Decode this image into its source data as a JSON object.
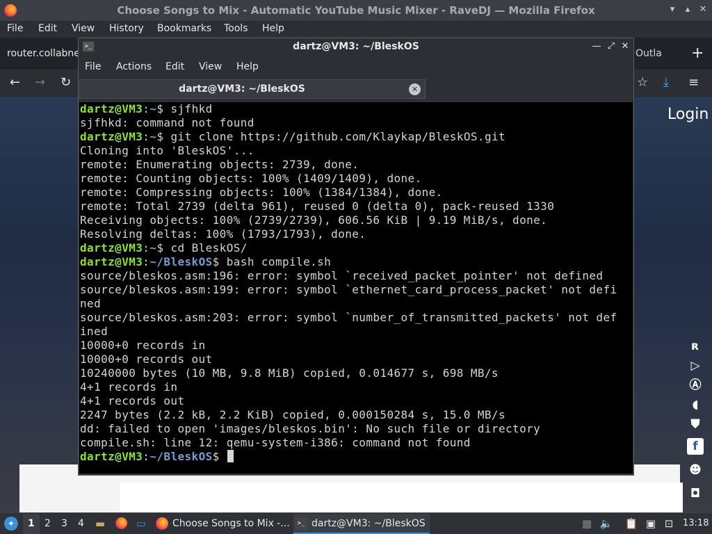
{
  "firefox": {
    "window_title": "Choose Songs to Mix - Automatic YouTube Music Mixer - RaveDJ — Mozilla Firefox",
    "menu": [
      "File",
      "Edit",
      "View",
      "History",
      "Bookmarks",
      "Tools",
      "Help"
    ],
    "tab_left_label": "router.collabne",
    "tab_right_label": "Outla",
    "page_login": "Login"
  },
  "terminal": {
    "window_title": "dartz@VM3: ~/BleskOS",
    "menu": [
      "File",
      "Actions",
      "Edit",
      "View",
      "Help"
    ],
    "tab_label": "dartz@VM3: ~/BleskOS",
    "lines": [
      {
        "user": "dartz@VM3",
        "path": "~",
        "cmd": " sjfhkd"
      },
      {
        "text": "sjfhkd: command not found"
      },
      {
        "user": "dartz@VM3",
        "path": "~",
        "cmd": " git clone https://github.com/Klaykap/BleskOS.git"
      },
      {
        "text": "Cloning into 'BleskOS'..."
      },
      {
        "text": "remote: Enumerating objects: 2739, done."
      },
      {
        "text": "remote: Counting objects: 100% (1409/1409), done."
      },
      {
        "text": "remote: Compressing objects: 100% (1384/1384), done."
      },
      {
        "text": "remote: Total 2739 (delta 961), reused 0 (delta 0), pack-reused 1330"
      },
      {
        "text": "Receiving objects: 100% (2739/2739), 606.56 KiB | 9.19 MiB/s, done."
      },
      {
        "text": "Resolving deltas: 100% (1793/1793), done."
      },
      {
        "user": "dartz@VM3",
        "path": "~",
        "cmd": " cd BleskOS/"
      },
      {
        "user": "dartz@VM3",
        "path": "~/BleskOS",
        "cmd": " bash compile.sh"
      },
      {
        "text": "source/bleskos.asm:196: error: symbol `received_packet_pointer' not defined"
      },
      {
        "text": "source/bleskos.asm:199: error: symbol `ethernet_card_process_packet' not defi"
      },
      {
        "text": "ned"
      },
      {
        "text": "source/bleskos.asm:203: error: symbol `number_of_transmitted_packets' not def"
      },
      {
        "text": "ined"
      },
      {
        "text": "10000+0 records in"
      },
      {
        "text": "10000+0 records out"
      },
      {
        "text": "10240000 bytes (10 MB, 9.8 MiB) copied, 0.014677 s, 698 MB/s"
      },
      {
        "text": "4+1 records in"
      },
      {
        "text": "4+1 records out"
      },
      {
        "text": "2247 bytes (2.2 kB, 2.2 KiB) copied, 0.000150284 s, 15.0 MB/s"
      },
      {
        "text": "dd: failed to open 'images/bleskos.bin': No such file or directory"
      },
      {
        "text": "compile.sh: line 12: qemu-system-i386: command not found"
      },
      {
        "user": "dartz@VM3",
        "path": "~/BleskOS",
        "cmd": " ",
        "cursor": true
      }
    ]
  },
  "taskbar": {
    "workspaces": [
      "1",
      "2",
      "3",
      "4"
    ],
    "tasks": [
      {
        "label": "Choose Songs to Mix -..."
      },
      {
        "label": "dartz@VM3: ~/BleskOS"
      }
    ],
    "clock": "13:18"
  }
}
